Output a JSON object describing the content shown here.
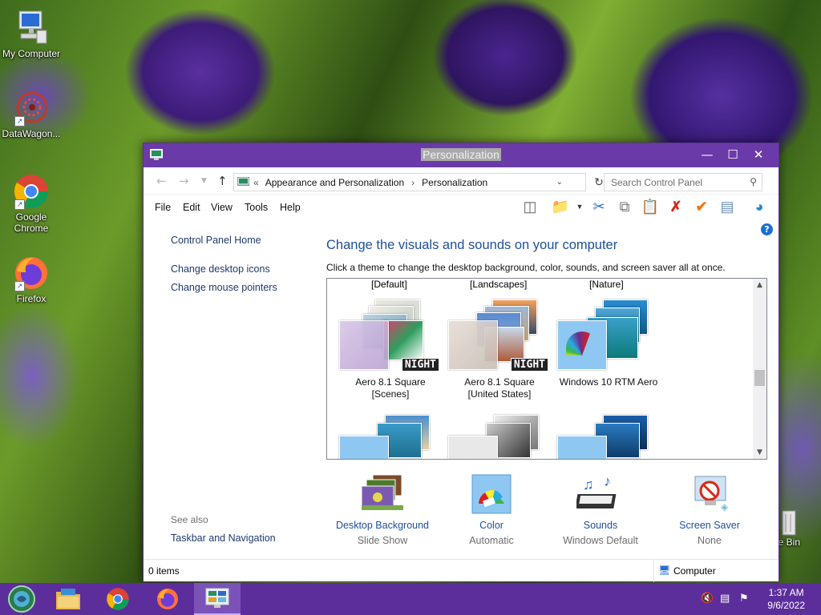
{
  "desktop": {
    "icons": [
      {
        "label": "My Computer"
      },
      {
        "label": "DataWagon..."
      },
      {
        "label": "Google Chrome"
      },
      {
        "label": "Firefox"
      }
    ],
    "recycle_partial": "le Bin"
  },
  "window": {
    "title": "Personalization",
    "address": {
      "chevrons": "«",
      "crumb1": "Appearance and Personalization",
      "separator": "›",
      "crumb2": "Personalization"
    },
    "search_placeholder": "Search Control Panel",
    "menu": [
      "File",
      "Edit",
      "View",
      "Tools",
      "Help"
    ],
    "left_nav": {
      "home": "Control Panel Home",
      "desktop_icons": "Change desktop icons",
      "mouse_pointers": "Change mouse pointers",
      "see_also": "See also",
      "taskbar": "Taskbar and Navigation"
    },
    "heading": "Change the visuals and sounds on your computer",
    "subtext": "Click a theme to change the desktop background, color, sounds, and screen saver all at once.",
    "theme_groups": [
      "[Default]",
      "[Landscapes]",
      "[Nature]"
    ],
    "themes": [
      {
        "line1": "Aero 8.1 Square",
        "line2": "[Scenes]",
        "badge": "NIGHT"
      },
      {
        "line1": "Aero 8.1 Square",
        "line2": "[United States]",
        "badge": "NIGHT"
      },
      {
        "line1": "Windows 10 RTM Aero",
        "line2": ""
      }
    ],
    "bottom": [
      {
        "label": "Desktop Background",
        "sub": "Slide Show"
      },
      {
        "label": "Color",
        "sub": "Automatic"
      },
      {
        "label": "Sounds",
        "sub": "Windows Default"
      },
      {
        "label": "Screen Saver",
        "sub": "None"
      }
    ],
    "status": {
      "items": "0 items",
      "location": "Computer"
    }
  },
  "taskbar": {
    "time": "1:37 AM",
    "date": "9/6/2022"
  },
  "colors": {
    "accent": "#6a3aa8",
    "taskbar": "#5c2e9b",
    "link": "#1e4f9c"
  }
}
